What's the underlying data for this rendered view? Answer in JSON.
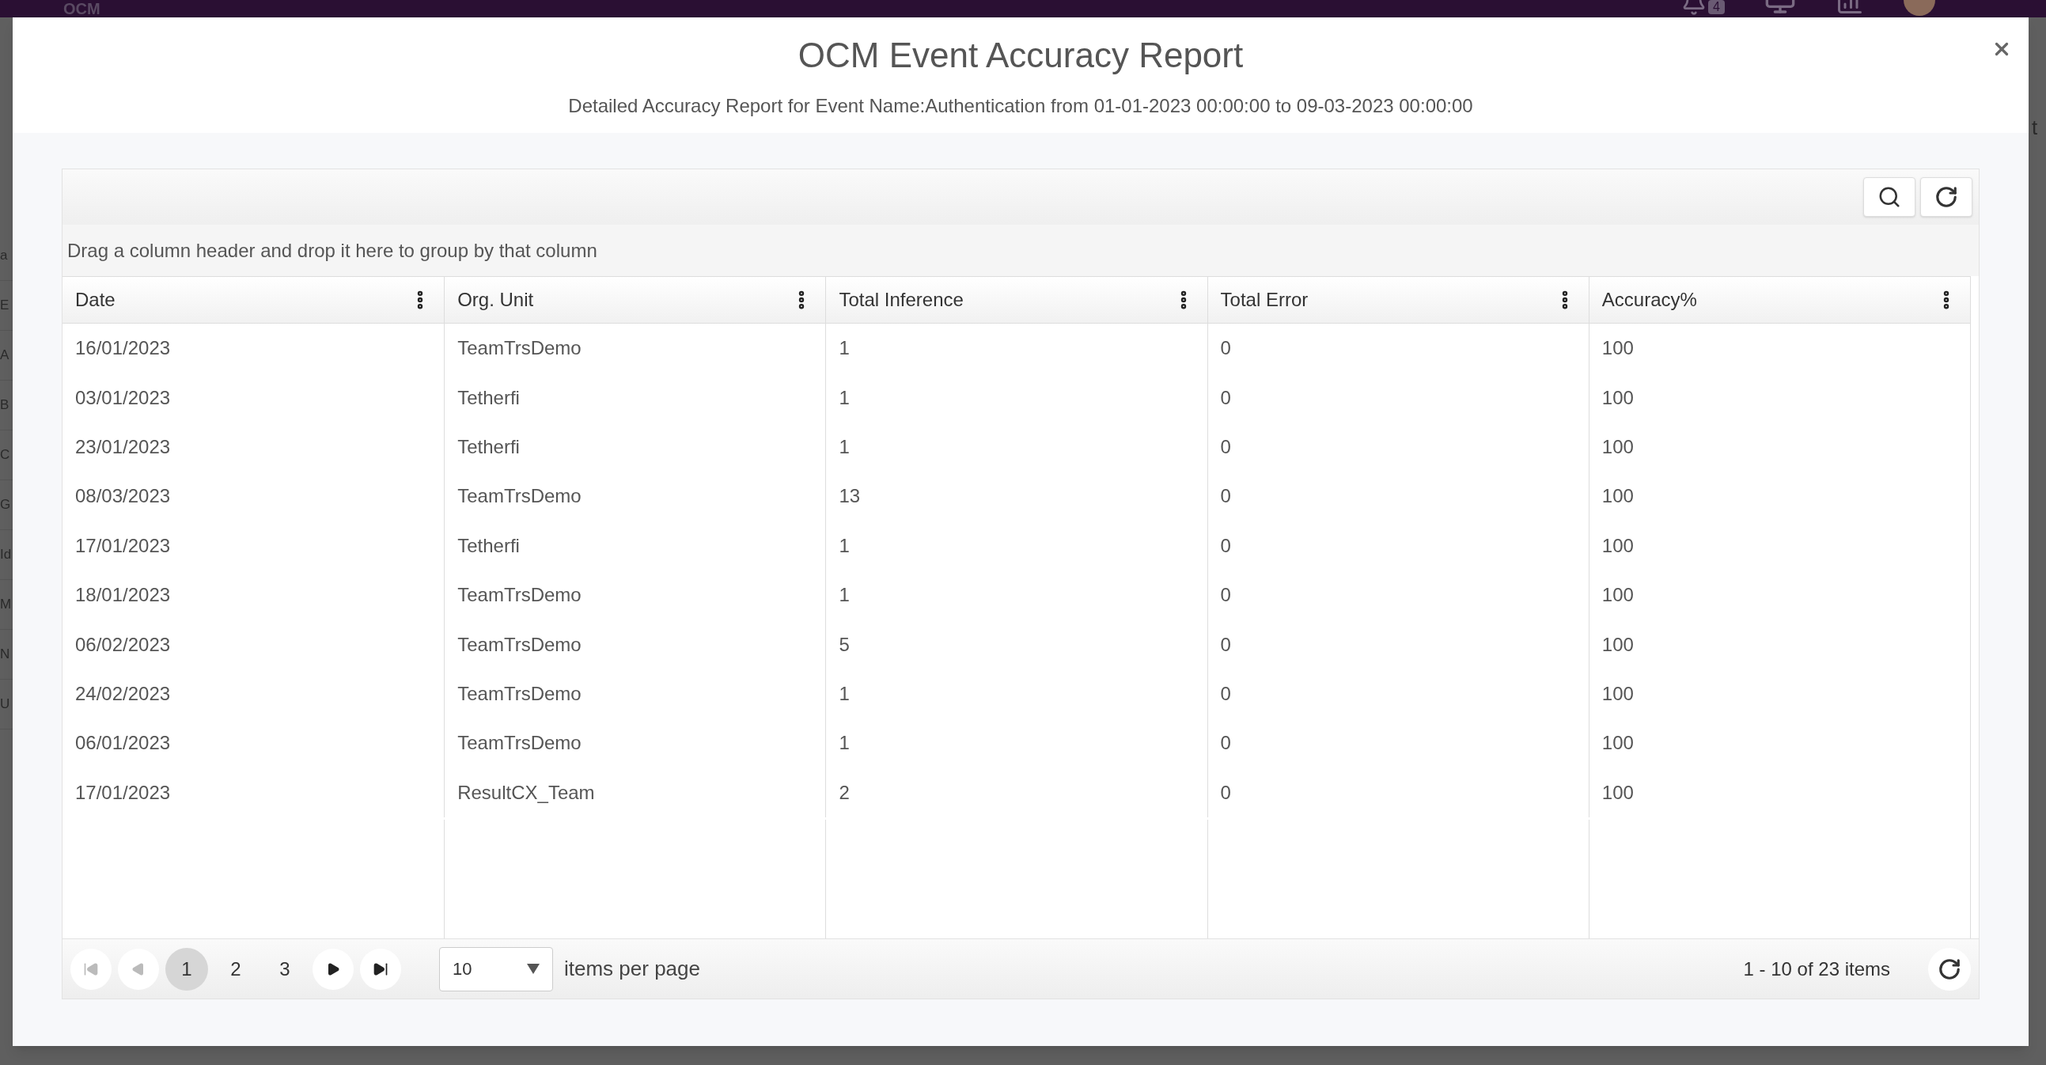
{
  "background": {
    "logo": "OCM",
    "notification_count": "4",
    "sidebar_fragments": [
      "a",
      "E",
      "A",
      "B",
      "C",
      "G",
      "Id",
      "M",
      "N",
      "U"
    ],
    "right_fragment": "t"
  },
  "dialog": {
    "title": "OCM Event Accuracy Report",
    "subtitle": "Detailed Accuracy Report for Event Name:Authentication from 01-01-2023 00:00:00 to 09-03-2023 00:00:00"
  },
  "grid": {
    "group_hint": "Drag a column header and drop it here to group by that column",
    "columns": [
      "Date",
      "Org. Unit",
      "Total Inference",
      "Total Error",
      "Accuracy%"
    ],
    "rows": [
      [
        "16/01/2023",
        "TeamTrsDemo",
        "1",
        "0",
        "100"
      ],
      [
        "03/01/2023",
        "Tetherfi",
        "1",
        "0",
        "100"
      ],
      [
        "23/01/2023",
        "Tetherfi",
        "1",
        "0",
        "100"
      ],
      [
        "08/03/2023",
        "TeamTrsDemo",
        "13",
        "0",
        "100"
      ],
      [
        "17/01/2023",
        "Tetherfi",
        "1",
        "0",
        "100"
      ],
      [
        "18/01/2023",
        "TeamTrsDemo",
        "1",
        "0",
        "100"
      ],
      [
        "06/02/2023",
        "TeamTrsDemo",
        "5",
        "0",
        "100"
      ],
      [
        "24/02/2023",
        "TeamTrsDemo",
        "1",
        "0",
        "100"
      ],
      [
        "06/01/2023",
        "TeamTrsDemo",
        "1",
        "0",
        "100"
      ],
      [
        "17/01/2023",
        "ResultCX_Team",
        "2",
        "0",
        "100"
      ]
    ]
  },
  "pager": {
    "pages": [
      {
        "label": "1",
        "selected": true
      },
      {
        "label": "2",
        "selected": false
      },
      {
        "label": "3",
        "selected": false
      }
    ],
    "page_size": "10",
    "page_size_label": "items per page",
    "summary": "1 - 10 of 23 items"
  }
}
